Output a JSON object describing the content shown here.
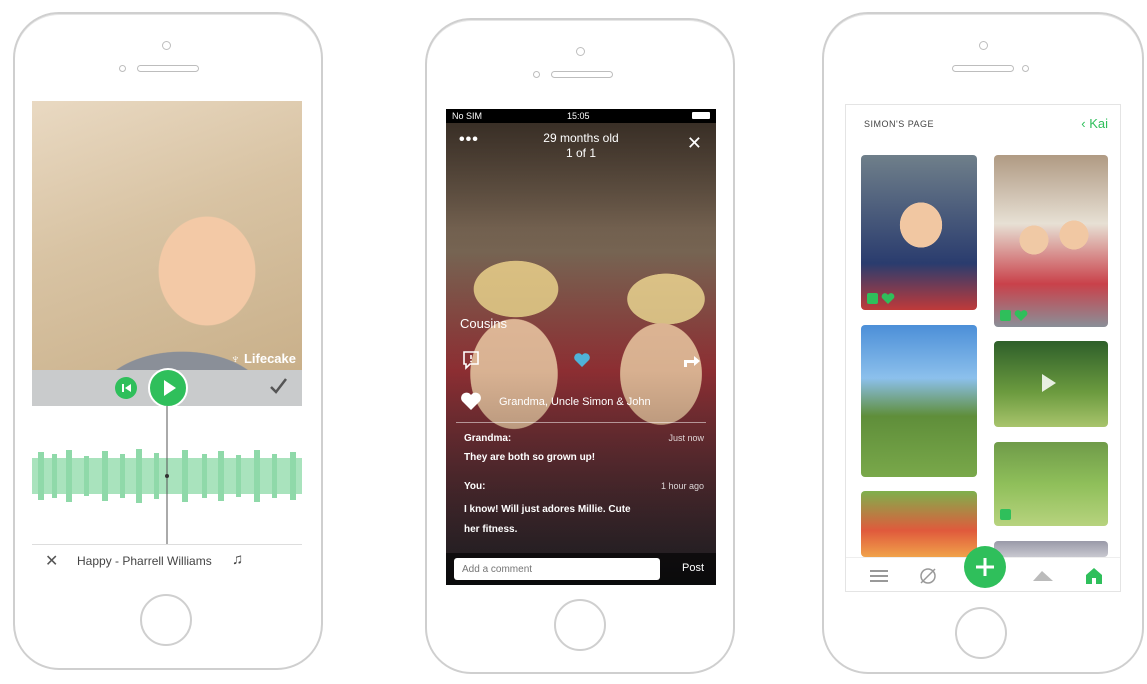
{
  "screen1": {
    "brand": "Lifecake",
    "song": "Happy - Pharrell Williams",
    "icons": {
      "rewind": "rewind-icon",
      "play": "play-icon",
      "confirm": "checkmark-icon",
      "close": "close-icon",
      "music": "music-note-icon"
    }
  },
  "screen2": {
    "status_left": "No SIM",
    "status_time": "15:05",
    "title": "29 months old",
    "subtitle": "1 of 1",
    "caption": "Cousins",
    "likes_text": "Grandma, Uncle Simon & John",
    "comments": [
      {
        "author": "Grandma:",
        "time": "Just now",
        "text": "They are both so grown up!"
      },
      {
        "author": "You:",
        "time": "1 hour ago",
        "text": "I know! Will just adores Millie. Cute her fitness."
      }
    ],
    "comment_placeholder": "Add a comment",
    "post_label": "Post"
  },
  "screen3": {
    "header_left": "SIMON'S PAGE",
    "header_right": "Kai",
    "nav_icons": [
      "menu-icon",
      "camera-off-icon",
      "add-icon",
      "send-icon",
      "home-icon"
    ],
    "accent": "#2fbf5b"
  }
}
